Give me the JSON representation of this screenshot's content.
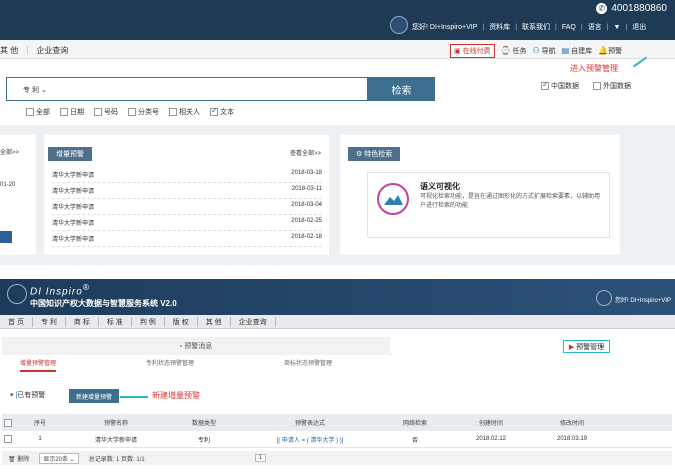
{
  "top": {
    "hotline": "4001880860",
    "greeting": "您好! DI+Inspiro+VIP",
    "links": [
      "资料库",
      "联系我们",
      "FAQ",
      "语言",
      "退出"
    ],
    "dropdown_caret": "▼"
  },
  "nav": {
    "left": [
      "其 他",
      "企业查询"
    ],
    "right": {
      "pay": "在线付费",
      "task": "任务",
      "nav": "导航",
      "self_db": "自建库",
      "alert": "预警"
    }
  },
  "annotations": {
    "enter_alert": "进入预警管理",
    "new_alert": "新建增量预警"
  },
  "search": {
    "type": "专 利",
    "button": "检索",
    "filters": [
      {
        "label": "全部",
        "checked": false
      },
      {
        "label": "日期",
        "checked": false
      },
      {
        "label": "号码",
        "checked": false
      },
      {
        "label": "分类号",
        "checked": false
      },
      {
        "label": "相关人",
        "checked": false
      },
      {
        "label": "文本",
        "checked": true
      }
    ],
    "data_opts": [
      {
        "label": "中国数据",
        "checked": true
      },
      {
        "label": "外国数据",
        "checked": false
      }
    ]
  },
  "left_fragment": {
    "view_all": "全部>>",
    "date": "01-20"
  },
  "incremental": {
    "title": "增量预警",
    "view_all": "查看全部>>",
    "rows": [
      {
        "name": "清华大学新申请",
        "date": "2018-03-18"
      },
      {
        "name": "清华大学新申请",
        "date": "2018-03-11"
      },
      {
        "name": "清华大学新申请",
        "date": "2018-03-04"
      },
      {
        "name": "清华大学新申请",
        "date": "2018-02-25"
      },
      {
        "name": "清华大学新申请",
        "date": "2018-02-18"
      }
    ]
  },
  "feature": {
    "title": "特色检索",
    "card_title": "语义可视化",
    "card_desc": "可视化检索功能，是旨在通过图形化的方式扩展检索要素，以辅助用户进行检索的功能"
  },
  "bottom": {
    "brand": "DI Inspiro",
    "brand_mark": "®",
    "system": "中国知识产权大数据与智慧服务系统 V2.0",
    "user": "您好! DI+Inspiro+VIP",
    "nav": [
      "首 页",
      "专 利",
      "商 标",
      "标 准",
      "判 例",
      "版 权",
      "其 他",
      "企业查询"
    ],
    "tab_left": "预警消息",
    "tab_right": "预警管理",
    "subtabs": [
      "增量预警管理",
      "专利状态预警管理",
      "商标状态预警管理"
    ],
    "section": "已有预警",
    "new_btn": "新建增量预警",
    "table": {
      "headers": [
        "序号",
        "预警名称",
        "数据类型",
        "预警表达式",
        "网络检索",
        "创建时间",
        "修改时间"
      ],
      "rows": [
        [
          "1",
          "清华大学新申请",
          "专利",
          "[( 申请人 = ( 清华大学 ) )]",
          "否",
          "2018.02.12",
          "2018.03.19"
        ]
      ]
    },
    "footer": {
      "delete": "删除",
      "per_page": "显示20条",
      "total": "总记录数: 1 页数: 1/1",
      "page": "1"
    }
  }
}
